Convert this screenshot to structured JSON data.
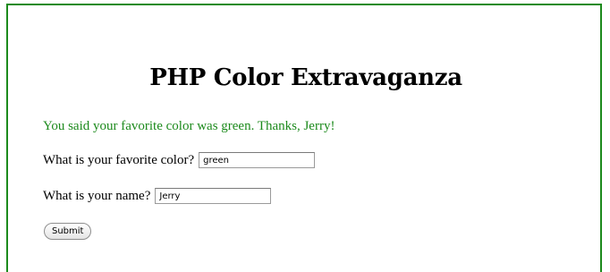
{
  "page": {
    "title": "PHP Color Extravaganza",
    "message": "You said your favorite color was green. Thanks, Jerry!",
    "accent_color": "#1c8a1c"
  },
  "form": {
    "color_label": "What is your favorite color?",
    "color_value": "green",
    "name_label": "What is your name?",
    "name_value": "Jerry",
    "submit_label": "Submit"
  }
}
